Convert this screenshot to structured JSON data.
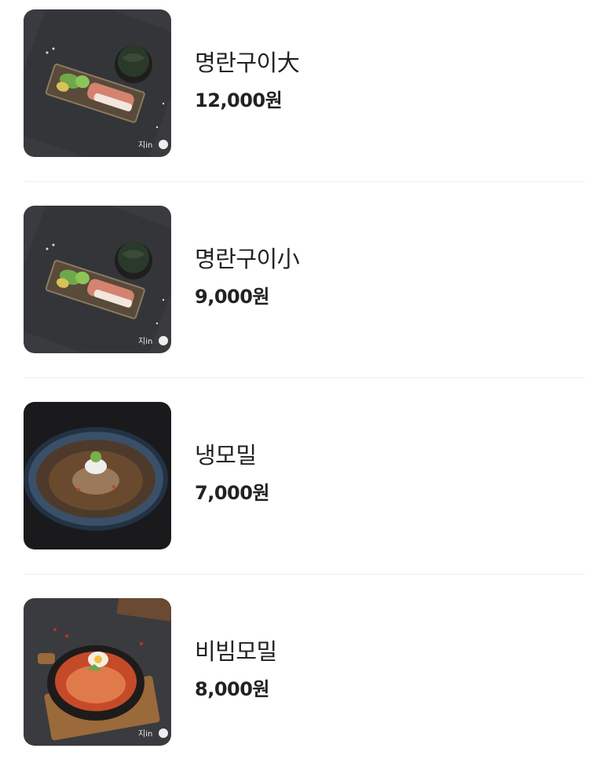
{
  "menu": {
    "items": [
      {
        "name": "명란구이大",
        "price": "12,000원",
        "image": "grilled-pollock-roe-platter",
        "watermark": "지in"
      },
      {
        "name": "명란구이小",
        "price": "9,000원",
        "image": "grilled-pollock-roe-platter",
        "watermark": "지in"
      },
      {
        "name": "냉모밀",
        "price": "7,000원",
        "image": "cold-buckwheat-noodles"
      },
      {
        "name": "비빔모밀",
        "price": "8,000원",
        "image": "spicy-buckwheat-noodles",
        "watermark": "지in"
      }
    ]
  }
}
